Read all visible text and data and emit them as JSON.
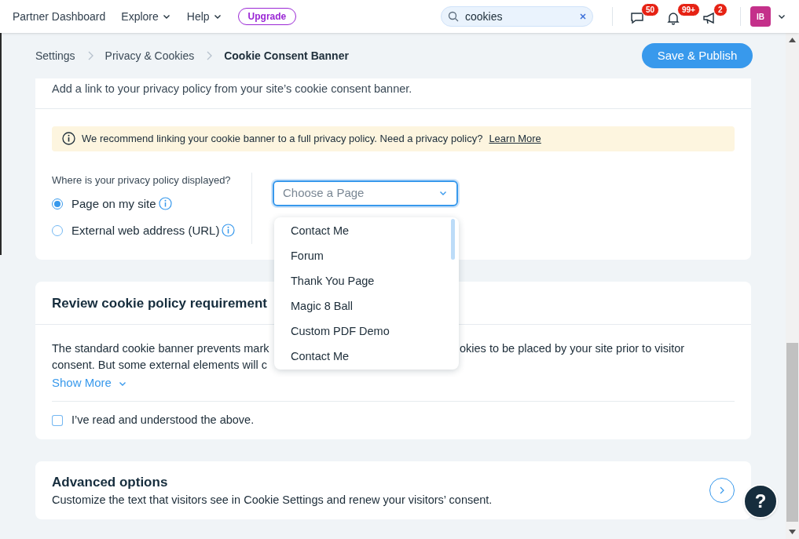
{
  "top_nav": {
    "items": [
      {
        "label": "Partner Dashboard",
        "has_menu": false
      },
      {
        "label": "Explore",
        "has_menu": true
      },
      {
        "label": "Help",
        "has_menu": true
      }
    ],
    "upgrade_button": "Upgrade",
    "search": {
      "value": "cookies"
    },
    "notifications": [
      {
        "kind": "chat",
        "count": "50"
      },
      {
        "kind": "bell",
        "count": "99+"
      },
      {
        "kind": "megaphone",
        "count": "2"
      }
    ],
    "avatar": "IB"
  },
  "breadcrumbs": [
    {
      "label": "Settings",
      "current": false
    },
    {
      "label": "Privacy & Cookies",
      "current": false
    },
    {
      "label": "Cookie Consent Banner",
      "current": true
    }
  ],
  "publish_button": "Save & Publish",
  "privacy_card": {
    "description": "Add a link to your privacy policy from your site’s cookie consent banner.",
    "notice": {
      "text": "We recommend linking your cookie banner to a full privacy policy. Need a privacy policy?",
      "link": "Learn More"
    },
    "question": "Where is your privacy policy displayed?",
    "options": [
      {
        "label": "Page on my site",
        "selected": true
      },
      {
        "label": "External web address (URL)",
        "selected": false
      }
    ],
    "page_select": {
      "placeholder": "Choose a Page",
      "open": true,
      "options": [
        "Contact Me",
        "Forum",
        "Thank You Page",
        "Magic 8 Ball",
        "Custom PDF Demo",
        "Contact Me"
      ]
    }
  },
  "review_card": {
    "title": "Review cookie policy requirement",
    "body_lines": [
      {
        "left": "The standard cookie banner prevents mark",
        "right": "okies to be placed by your site prior to visitor"
      },
      {
        "left": "consent. But some external elements will c"
      }
    ],
    "show_more": "Show More",
    "acknowledge": {
      "label": "I’ve read and understood the above.",
      "checked": false
    }
  },
  "advanced_card": {
    "title": "Advanced options",
    "description": "Customize the text that visitors see in Cookie Settings and renew your visitors’ consent."
  },
  "help_button": "?"
}
